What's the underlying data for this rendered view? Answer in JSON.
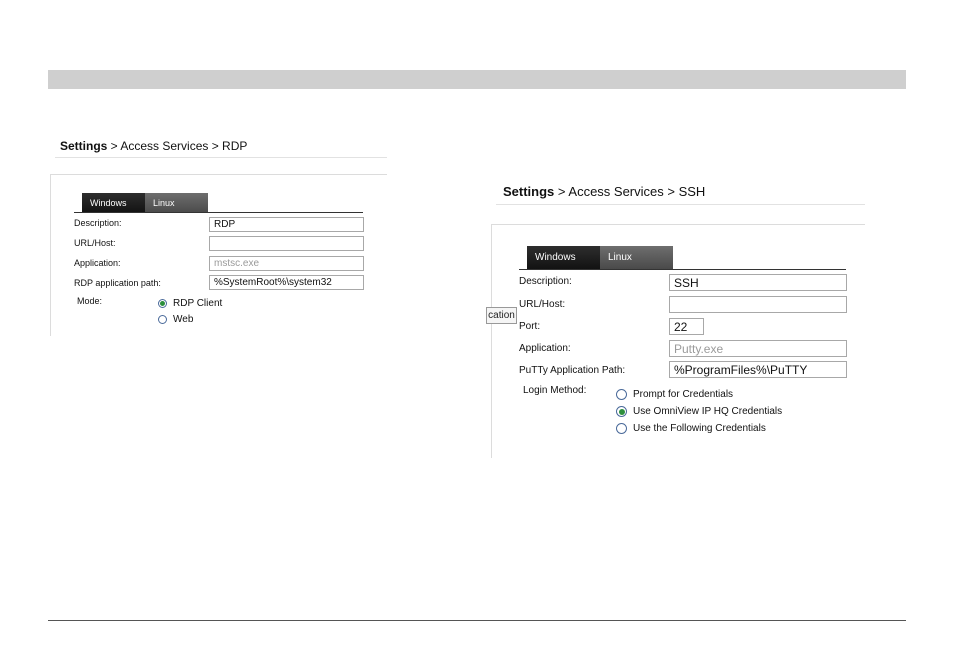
{
  "rdp": {
    "breadcrumb": {
      "root": "Settings",
      "rest": " > Access Services > RDP"
    },
    "tabs": [
      "Windows",
      "Linux"
    ],
    "fields": {
      "description": {
        "label": "Description:",
        "value": "RDP"
      },
      "url_host": {
        "label": "URL/Host:",
        "value": ""
      },
      "application": {
        "label": "Application:",
        "value": "mstsc.exe"
      },
      "app_path": {
        "label": "RDP application path:",
        "value": "%SystemRoot%\\system32"
      }
    },
    "mode": {
      "label": "Mode:",
      "options": [
        "RDP Client",
        "Web"
      ],
      "selected": "RDP Client"
    }
  },
  "ssh": {
    "breadcrumb": {
      "root": "Settings",
      "rest": " > Access Services > SSH"
    },
    "tabs": [
      "Windows",
      "Linux"
    ],
    "tooltip": "cation",
    "fields": {
      "description": {
        "label": "Description:",
        "value": "SSH"
      },
      "url_host": {
        "label": "URL/Host:",
        "value": ""
      },
      "port": {
        "label": "Port:",
        "value": "22"
      },
      "application": {
        "label": "Application:",
        "value": "Putty.exe"
      },
      "app_path": {
        "label": "PuTTy Application Path:",
        "value": "%ProgramFiles%\\PuTTY"
      }
    },
    "login": {
      "label": "Login Method:",
      "options": [
        "Prompt for Credentials",
        "Use OmniView IP HQ Credentials",
        "Use the Following Credentials"
      ],
      "selected": "Use OmniView IP HQ Credentials"
    }
  }
}
